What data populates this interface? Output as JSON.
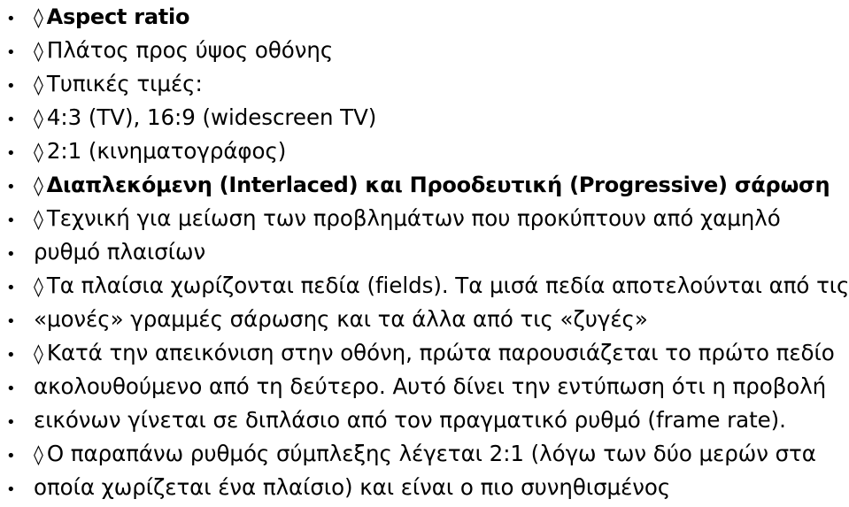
{
  "slide": {
    "background_color": "#ffffff",
    "text_color": "#000000",
    "bullet_glyph": "•",
    "diamond_glyph": "◊",
    "lines": [
      {
        "id": "line-1",
        "bullet": "•",
        "diamond": "◊",
        "bold": true,
        "text": "Aspect ratio"
      },
      {
        "id": "line-2",
        "bullet": "•",
        "diamond": "◊",
        "bold": false,
        "text": "Πλάτος προς ύψος οθόνης"
      },
      {
        "id": "line-3",
        "bullet": "•",
        "diamond": "◊",
        "bold": false,
        "text": "Τυπικές τιμές:"
      },
      {
        "id": "line-4",
        "bullet": "•",
        "diamond": "◊",
        "bold": false,
        "text": "4:3 (TV), 16:9 (widescreen TV)"
      },
      {
        "id": "line-5",
        "bullet": "•",
        "diamond": "◊",
        "bold": false,
        "text": "2:1 (κινηματογράφος)"
      },
      {
        "id": "line-6",
        "bullet": "•",
        "diamond": "◊",
        "bold": true,
        "text": "Διαπλεκόμενη (Interlaced) και Προοδευτική (Progressive) σάρωση"
      },
      {
        "id": "line-7",
        "bullet": "•",
        "diamond": "◊",
        "bold": false,
        "text": "Τεχνική για μείωση των προβλημάτων που προκύπτουν από χαμηλό"
      },
      {
        "id": "line-8",
        "bullet": "•",
        "diamond": "",
        "bold": false,
        "text": "ρυθμό πλαισίων"
      },
      {
        "id": "line-9",
        "bullet": "•",
        "diamond": "◊",
        "bold": false,
        "text": "Τα πλαίσια χωρίζονται πεδία (fields). Τα μισά πεδία αποτελούνται από τις"
      },
      {
        "id": "line-10",
        "bullet": "•",
        "diamond": "",
        "bold": false,
        "text": "«μονές» γραμμές σάρωσης και τα άλλα από τις «ζυγές»"
      },
      {
        "id": "line-11",
        "bullet": "•",
        "diamond": "◊",
        "bold": false,
        "text": "Κατά την απεικόνιση στην οθόνη, πρώτα παρουσιάζεται το πρώτο πεδίο"
      },
      {
        "id": "line-12",
        "bullet": "•",
        "diamond": "",
        "bold": false,
        "text": "ακολουθούμενο από τη δεύτερο. Αυτό δίνει την εντύπωση ότι η προβολή"
      },
      {
        "id": "line-13",
        "bullet": "•",
        "diamond": "",
        "bold": false,
        "text": "εικόνων γίνεται σε διπλάσιο από τον πραγματικό ρυθμό (frame rate)."
      },
      {
        "id": "line-14",
        "bullet": "•",
        "diamond": "◊",
        "bold": false,
        "text": "Ο παραπάνω ρυθμός σύμπλεξης λέγεται 2:1 (λόγω των δύο μερών στα"
      },
      {
        "id": "line-15",
        "bullet": "•",
        "diamond": "",
        "bold": false,
        "text": "οποία χωρίζεται ένα πλαίσιο) και είναι ο πιο συνηθισμένος"
      }
    ]
  }
}
